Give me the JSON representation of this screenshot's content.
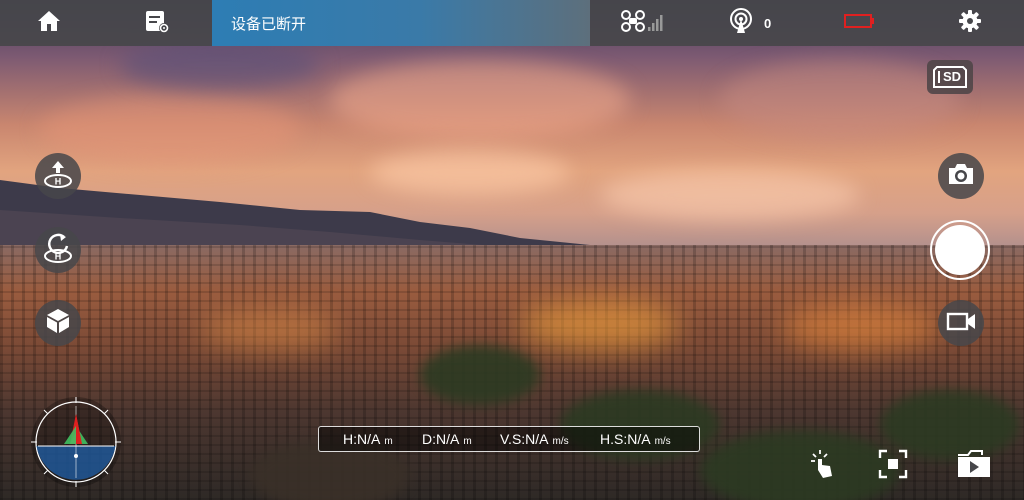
{
  "topbar": {
    "home_icon": "home-icon",
    "checklist_icon": "checklist-settings-icon",
    "connection_status": "设备已断开",
    "drone_signal_icon": "drone-signal-icon",
    "satellite_icon": "gps-satellite-icon",
    "satellite_count": "0",
    "battery_icon": "battery-empty-icon",
    "settings_icon": "gear-icon"
  },
  "left_controls": [
    {
      "name": "takeoff-button",
      "icon": "takeoff-icon"
    },
    {
      "name": "return-home-button",
      "icon": "return-home-icon"
    },
    {
      "name": "3d-view-button",
      "icon": "cube-icon"
    }
  ],
  "right_controls": {
    "sd_label": "SD",
    "camera_mode_icon": "camera-icon",
    "video_mode_icon": "video-camera-icon"
  },
  "telemetry": {
    "height": {
      "label": "H:N/A",
      "unit": "m"
    },
    "distance": {
      "label": "D:N/A",
      "unit": "m"
    },
    "vertical_speed": {
      "label": "V.S:N/A",
      "unit": "m/s"
    },
    "horizontal_speed": {
      "label": "H.S:N/A",
      "unit": "m/s"
    }
  },
  "bottom_controls": {
    "gesture_icon": "tap-gesture-icon",
    "fullscreen_icon": "fullscreen-icon",
    "media_icon": "media-library-icon"
  },
  "colors": {
    "topbar": "#46464a",
    "status_accent": "#2d7db4",
    "battery_warning": "#e02020"
  }
}
